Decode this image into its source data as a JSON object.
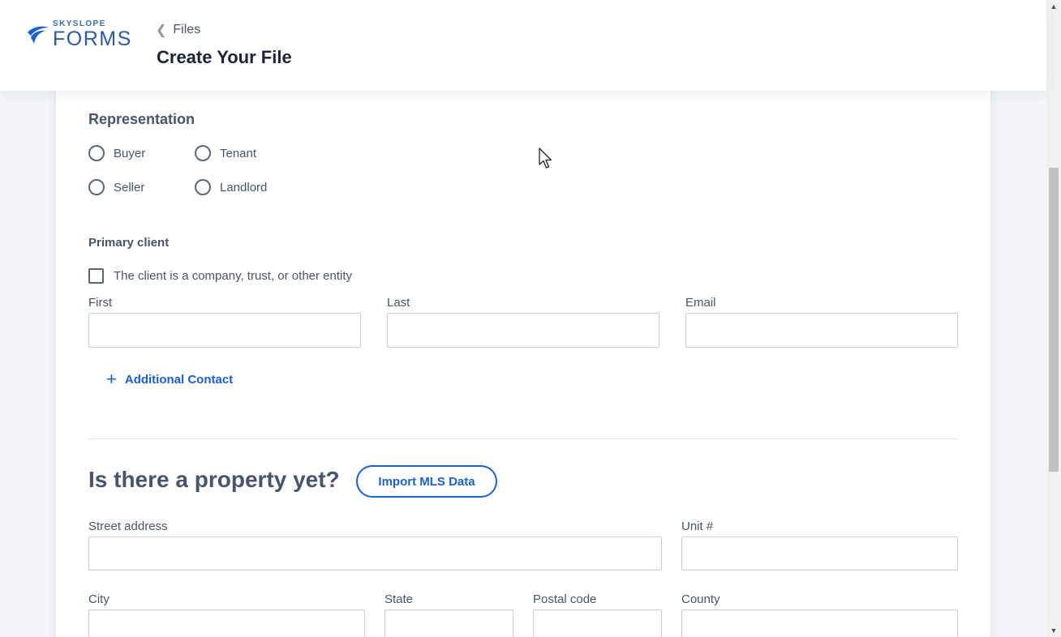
{
  "header": {
    "logo_small": "SKYSLOPE",
    "logo_big": "FORMS",
    "breadcrumb": "Files",
    "title": "Create Your File"
  },
  "representation": {
    "title": "Representation",
    "options": [
      "Buyer",
      "Tenant",
      "Seller",
      "Landlord"
    ]
  },
  "primary_client": {
    "title": "Primary client",
    "entity_checkbox_label": "The client is a company, trust, or other entity",
    "fields": {
      "first": "First",
      "last": "Last",
      "email": "Email"
    },
    "additional_contact": "Additional Contact"
  },
  "property": {
    "title": "Is there a property yet?",
    "import_button": "Import MLS Data",
    "fields": {
      "street": "Street address",
      "unit": "Unit #",
      "city": "City",
      "state": "State",
      "postal": "Postal code",
      "county": "County"
    }
  },
  "colors": {
    "accent": "#1a5fd0",
    "text": "#46556b",
    "title": "#1a2535"
  },
  "icons": {
    "breadcrumb": "chevron-left-icon",
    "add": "plus-icon",
    "logo": "skyslope-swoosh-icon"
  }
}
